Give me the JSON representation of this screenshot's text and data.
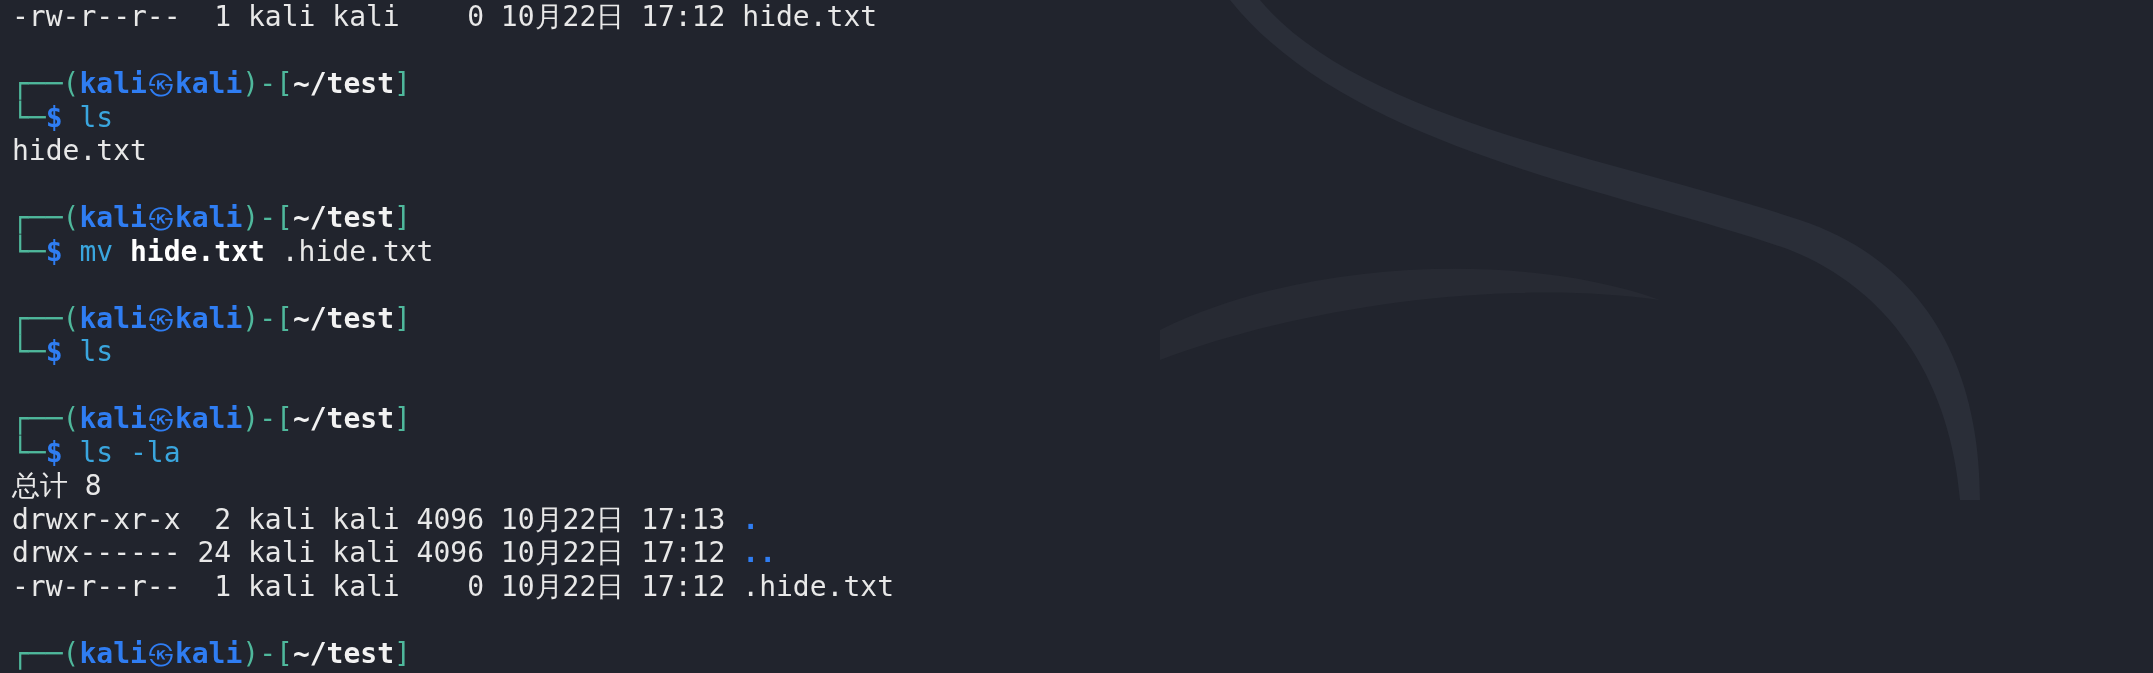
{
  "lines": [
    {
      "kind": "output",
      "text": "-rw-r--r--  1 kali kali    0 10月22日 17:12 hide.txt"
    },
    {
      "kind": "blank"
    },
    {
      "kind": "prompt",
      "open": "┌──(",
      "user": "kali",
      "at": "㉿",
      "host": "kali",
      "mid": ")-[",
      "path": "~/test",
      "close": "]",
      "lead": "└─",
      "dollar": "$",
      "command": [
        {
          "text": "ls",
          "kind": "cmd"
        }
      ]
    },
    {
      "kind": "output",
      "text": "hide.txt"
    },
    {
      "kind": "blank"
    },
    {
      "kind": "prompt",
      "open": "┌──(",
      "user": "kali",
      "at": "㉿",
      "host": "kali",
      "mid": ")-[",
      "path": "~/test",
      "close": "]",
      "lead": "└─",
      "dollar": "$",
      "command": [
        {
          "text": "mv",
          "kind": "cmd"
        },
        {
          "text": "hide.txt",
          "kind": "file"
        },
        {
          "text": ".hide.txt",
          "kind": "arg"
        }
      ]
    },
    {
      "kind": "blank"
    },
    {
      "kind": "prompt",
      "open": "┌──(",
      "user": "kali",
      "at": "㉿",
      "host": "kali",
      "mid": ")-[",
      "path": "~/test",
      "close": "]",
      "lead": "└─",
      "dollar": "$",
      "command": [
        {
          "text": "ls",
          "kind": "cmd"
        }
      ]
    },
    {
      "kind": "blank"
    },
    {
      "kind": "prompt",
      "open": "┌──(",
      "user": "kali",
      "at": "㉿",
      "host": "kali",
      "mid": ")-[",
      "path": "~/test",
      "close": "]",
      "lead": "└─",
      "dollar": "$",
      "command": [
        {
          "text": "ls",
          "kind": "cmd"
        },
        {
          "text": "-la",
          "kind": "cmd"
        }
      ]
    },
    {
      "kind": "output",
      "text": "总计 8"
    },
    {
      "kind": "listing",
      "text": "drwxr-xr-x  2 kali kali 4096 10月22日 17:13",
      "name": ".",
      "directory": true
    },
    {
      "kind": "listing",
      "text": "drwx------ 24 kali kali 4096 10月22日 17:12",
      "name": "..",
      "directory": true
    },
    {
      "kind": "listing",
      "text": "-rw-r--r--  1 kali kali    0 10月22日 17:12",
      "name": ".hide.txt",
      "directory": false
    },
    {
      "kind": "blank"
    },
    {
      "kind": "prompt_top",
      "open": "┌──(",
      "user": "kali",
      "at": "㉿",
      "host": "kali",
      "mid": ")-[",
      "path": "~/test",
      "close": "]"
    }
  ]
}
